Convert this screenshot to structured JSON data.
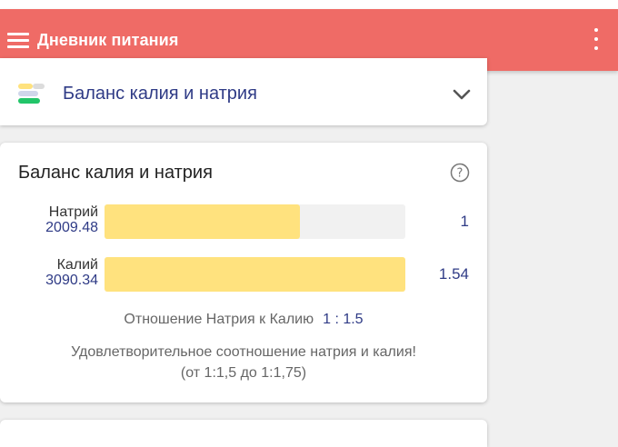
{
  "app_bar": {
    "title": "Дневник питания",
    "background": "#ef6b66",
    "menu_icon": "hamburger-menu-icon",
    "overflow_icon": "more-vertical-icon"
  },
  "section": {
    "title": "Баланс калия и натрия",
    "icon": "balance-bars-icon",
    "toggle_icon": "chevron-down-icon"
  },
  "balance_card": {
    "title": "Баланс калия и натрия",
    "help_icon": "help-circle-icon",
    "rows": [
      {
        "name": "Натрий",
        "value": "2009.48",
        "ratio": "1",
        "fill_fraction": 0.65
      },
      {
        "name": "Калий",
        "value": "3090.34",
        "ratio": "1.54",
        "fill_fraction": 1.0
      }
    ],
    "bar_color": "#ffe27e",
    "ratio_label": "Отношение Натрия к Калию",
    "ratio_value": "1 : 1.5",
    "message_line1": "Удовлетворительное соотношение натрия и калия!",
    "message_line2": "(от 1:1,5 до 1:1,75)"
  }
}
